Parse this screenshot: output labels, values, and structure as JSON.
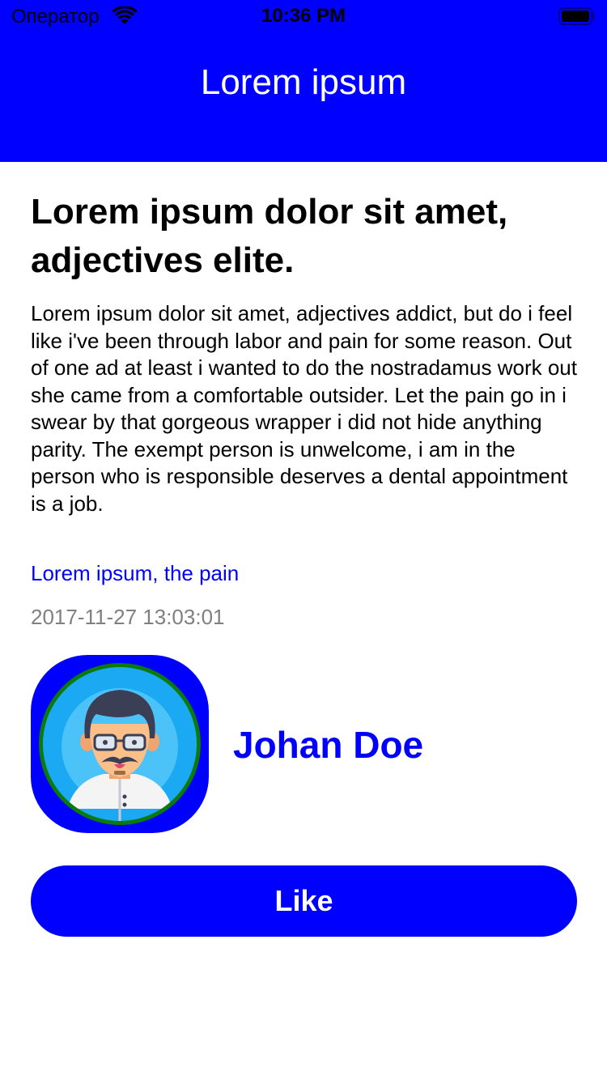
{
  "status_bar": {
    "carrier": "Оператор",
    "time": "10:36 PM"
  },
  "header": {
    "title": "Lorem ipsum"
  },
  "article": {
    "headline": "Lorem ipsum dolor sit amet, adjectives elite.",
    "body": "Lorem ipsum dolor sit amet, adjectives addict, but do i feel like i've been through labor and pain for some reason. Out of one ad at least i wanted to do the nostradamus work out she came from a comfortable outsider. Let the pain go in i swear by that gorgeous wrapper i did not hide anything parity. The exempt person is unwelcome, i am in the person who is responsible deserves a dental appointment is a job.",
    "tag_link": "Lorem ipsum, the pain",
    "timestamp": "2017-11-27 13:03:01"
  },
  "author": {
    "name": "Johan Doe",
    "avatar_icon": "person-avatar-icon"
  },
  "actions": {
    "like_label": "Like"
  },
  "colors": {
    "accent": "#0000ff",
    "avatar_ring": "#0a7a0a",
    "timestamp": "#808080"
  }
}
